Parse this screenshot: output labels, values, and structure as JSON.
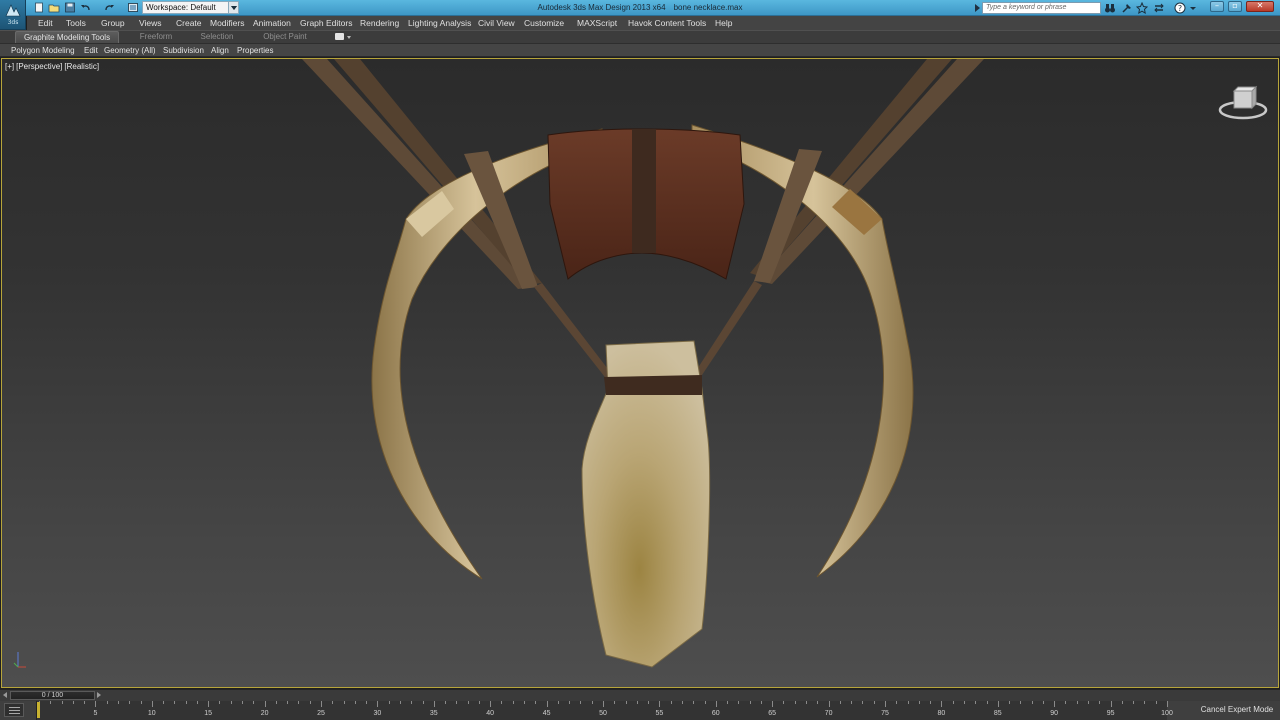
{
  "window": {
    "app_title": "Autodesk 3ds Max Design 2013 x64",
    "file_name": "bone necklace.max",
    "logo_sub": "3ds"
  },
  "quick_access": {
    "workspace_label": "Workspace: Default",
    "icons": [
      "app-menu-icon",
      "new-file-icon",
      "open-file-icon",
      "save-file-icon",
      "undo-icon",
      "redo-icon",
      "project-folder-icon"
    ]
  },
  "search": {
    "placeholder": "Type a keyword or phrase"
  },
  "menu": {
    "items": [
      "Edit",
      "Tools",
      "Group",
      "Views",
      "Create",
      "Modifiers",
      "Animation",
      "Graph Editors",
      "Rendering",
      "Lighting Analysis",
      "Civil View",
      "Customize",
      "MAXScript",
      "Havok Content Tools",
      "Help"
    ]
  },
  "ribbon": {
    "tabs": [
      "Graphite Modeling Tools",
      "Freeform",
      "Selection",
      "Object Paint"
    ],
    "active_tab": "Graphite Modeling Tools",
    "panels": [
      "Polygon Modeling",
      "Edit",
      "Geometry (All)",
      "Subdivision",
      "Align",
      "Properties"
    ]
  },
  "viewport": {
    "label_parts": [
      "[+]",
      "[Perspective]",
      "[Realistic]"
    ],
    "border_color": "#b7a53a",
    "scene_object": "bone necklace"
  },
  "timeline": {
    "slider_text": "0 / 100",
    "frame_labels": [
      "5",
      "10",
      "15",
      "20",
      "25",
      "30",
      "35",
      "40",
      "45",
      "50",
      "55",
      "60",
      "65",
      "70",
      "75",
      "80",
      "85",
      "90",
      "95",
      "100"
    ],
    "current_frame": 0,
    "total_frames": 100,
    "expert_mode_label": "Cancel Expert Mode"
  },
  "colors": {
    "titlebar": "#4aa8d6",
    "bone": "#cfb98a",
    "leather": "#5a2e1e",
    "strap": "#5b4634",
    "accent_frame": "#c8b230"
  }
}
